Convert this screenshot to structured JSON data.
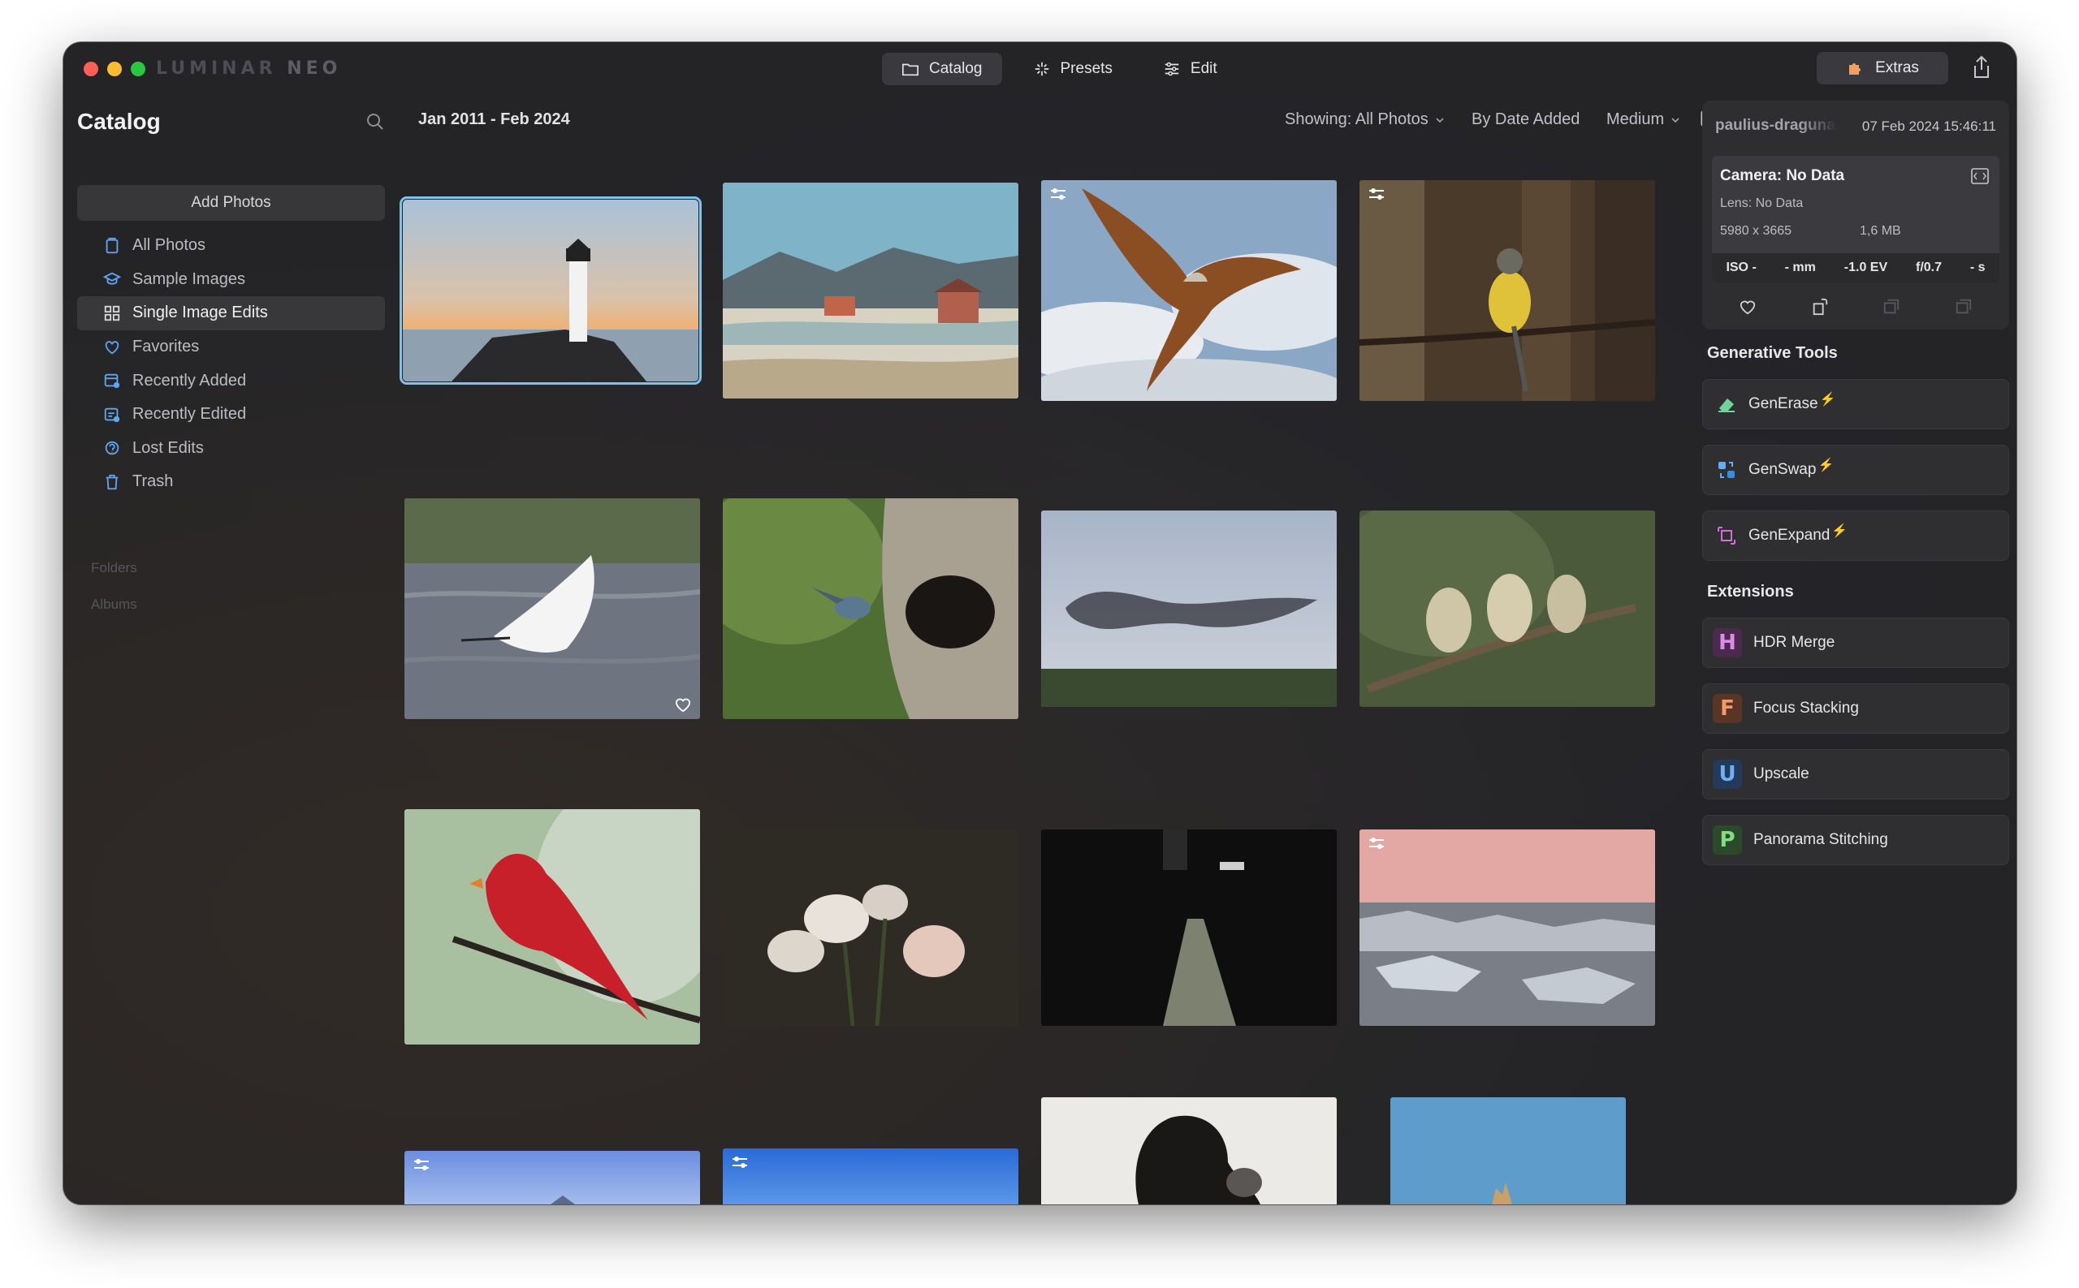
{
  "app": {
    "name_part1": "LUMINAR",
    "name_part2": "NEO"
  },
  "modes": [
    {
      "label": "Catalog",
      "icon": "folder-icon",
      "active": true
    },
    {
      "label": "Presets",
      "icon": "sparkle-icon",
      "active": false
    },
    {
      "label": "Edit",
      "icon": "sliders-icon",
      "active": false
    }
  ],
  "extras_label": "Extras",
  "sidebar": {
    "title": "Catalog",
    "add_photos": "Add Photos",
    "items": [
      {
        "label": "All Photos",
        "icon": "all-photos-icon"
      },
      {
        "label": "Sample Images",
        "icon": "graduation-cap-icon"
      },
      {
        "label": "Single Image Edits",
        "icon": "grid-icon",
        "active": true
      },
      {
        "label": "Favorites",
        "icon": "heart-icon"
      },
      {
        "label": "Recently Added",
        "icon": "recently-added-icon"
      },
      {
        "label": "Recently Edited",
        "icon": "recently-edited-icon"
      },
      {
        "label": "Lost Edits",
        "icon": "lost-edits-icon"
      },
      {
        "label": "Trash",
        "icon": "trash-icon"
      }
    ],
    "folders_label": "Folders",
    "albums_label": "Albums"
  },
  "toolbar": {
    "date_range": "Jan 2011 - Feb 2024",
    "showing": "Showing: All Photos",
    "sort": "By Date Added",
    "size": "Medium"
  },
  "photos": [
    {
      "subject": "lighthouse",
      "selected": true
    },
    {
      "subject": "fjord-cabins"
    },
    {
      "subject": "red-kite",
      "edited": true
    },
    {
      "subject": "yellow-wagtail",
      "edited": true
    },
    {
      "subject": "egret",
      "favorite": true
    },
    {
      "subject": "bird-tree-hollow"
    },
    {
      "subject": "starling-murmuration"
    },
    {
      "subject": "fledglings"
    },
    {
      "subject": "cardinal"
    },
    {
      "subject": "lilies"
    },
    {
      "subject": "dark-corridor"
    },
    {
      "subject": "icebergs",
      "edited": true
    },
    {
      "subject": "blue-sky-1",
      "edited": true
    },
    {
      "subject": "blue-sky-2",
      "edited": true
    },
    {
      "subject": "silhouette"
    },
    {
      "subject": "blue-sky-3"
    }
  ],
  "info": {
    "user": "paulius-dragunas",
    "date": "07 Feb 2024 15:46:11",
    "camera": "Camera: No Data",
    "lens": "Lens: No Data",
    "resolution": "5980 x 3665",
    "filesize": "1,6 MB",
    "iso": "ISO -",
    "focal": "- mm",
    "ev": "-1.0 EV",
    "aperture": "f/0.7",
    "shutter": "- s"
  },
  "generative": {
    "title": "Generative Tools",
    "tools": [
      {
        "label": "GenErase",
        "icon": "eraser-icon",
        "color": "#6fd39a"
      },
      {
        "label": "GenSwap",
        "icon": "swap-icon",
        "color": "#5fb0f0"
      },
      {
        "label": "GenExpand",
        "icon": "expand-icon",
        "color": "#d46fd9"
      }
    ]
  },
  "extensions": {
    "title": "Extensions",
    "items": [
      {
        "label": "HDR Merge",
        "letter": "H",
        "color": "#d96be0"
      },
      {
        "label": "Focus Stacking",
        "letter": "F",
        "color": "#f08a5d"
      },
      {
        "label": "Upscale",
        "letter": "U",
        "color": "#5fa6f0"
      },
      {
        "label": "Panorama Stitching",
        "letter": "P",
        "color": "#7cd67a"
      }
    ]
  }
}
